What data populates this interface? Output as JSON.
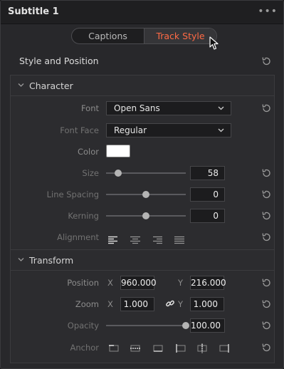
{
  "panel": {
    "title": "Subtitle 1",
    "more_icon": "more-horizontal-icon"
  },
  "tabs": [
    {
      "label": "Captions",
      "active": false
    },
    {
      "label": "Track Style",
      "active": true,
      "color": "#ff6a45"
    }
  ],
  "style_position": {
    "title": "Style and Position"
  },
  "character": {
    "label": "Character",
    "font": {
      "label": "Font",
      "value": "Open Sans"
    },
    "font_face": {
      "label": "Font Face",
      "value": "Regular"
    },
    "color": {
      "label": "Color",
      "value": "#ffffff"
    },
    "size": {
      "label": "Size",
      "value": "58",
      "slider_fraction": 0.15
    },
    "line_spacing": {
      "label": "Line Spacing",
      "value": "0",
      "slider_fraction": 0.5
    },
    "kerning": {
      "label": "Kerning",
      "value": "0",
      "slider_fraction": 0.5
    },
    "alignment": {
      "label": "Alignment",
      "options": [
        "align-left-icon",
        "align-center-icon",
        "align-right-icon",
        "align-justify-icon"
      ],
      "selected": "align-left-icon"
    }
  },
  "transform": {
    "label": "Transform",
    "position": {
      "label": "Position",
      "x_label": "X",
      "x": "960.000",
      "y_label": "Y",
      "y": "216.000"
    },
    "zoom": {
      "label": "Zoom",
      "x_label": "X",
      "x": "1.000",
      "y_label": "Y",
      "y": "1.000",
      "link_icon": "link-icon"
    },
    "opacity": {
      "label": "Opacity",
      "value": "100.00",
      "slider_fraction": 1.0
    },
    "anchor": {
      "label": "Anchor",
      "options": [
        "anchor-top-left-icon",
        "anchor-top-center-icon",
        "anchor-top-right-icon",
        "anchor-bottom-left-icon",
        "anchor-center-icon",
        "anchor-bottom-right-icon"
      ]
    }
  },
  "icons": {
    "reset": "reset-icon",
    "chevron": "chevron-down-icon",
    "cursor": "mouse-pointer-icon"
  }
}
